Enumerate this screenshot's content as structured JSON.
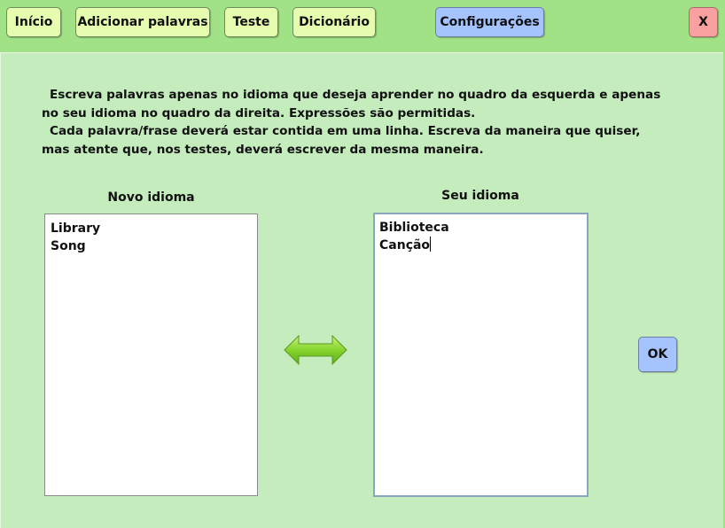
{
  "nav": {
    "inicio": "Início",
    "adicionar": "Adicionar palavras",
    "teste": "Teste",
    "dicionario": "Dicionário",
    "configuracoes": "Configurações",
    "close": "X"
  },
  "instructions": {
    "paragraph1": "Escreva palavras apenas no idioma que deseja aprender no quadro da esquerda e apenas no seu idioma no quadro da direita. Expressões são permitidas.",
    "paragraph2": "Cada palavra/frase deverá estar contida em uma linha. Escreva da maneira que quiser, mas atente que, nos testes, deverá escrever da mesma maneira."
  },
  "left_column": {
    "label": "Novo idioma",
    "text": "Library\nSong"
  },
  "right_column": {
    "label": "Seu idioma",
    "text": "Biblioteca\nCanção"
  },
  "swap_icon": "double-arrow-icon",
  "ok_label": "OK",
  "colors": {
    "background": "#a2e286",
    "panel": "#c4ecbd",
    "nav_button": "#e6fcae",
    "active_button": "#a4c3ff",
    "close_button": "#f9a0a0",
    "arrow": "#7ccf2c"
  }
}
